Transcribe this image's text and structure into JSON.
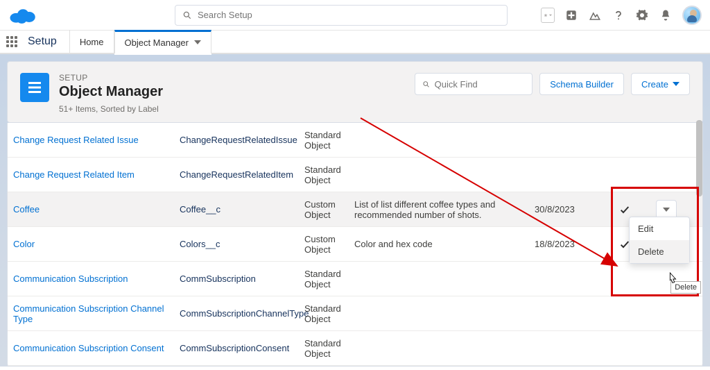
{
  "globalSearch": {
    "placeholder": "Search Setup"
  },
  "nav": {
    "appName": "Setup",
    "tabs": [
      {
        "label": "Home"
      },
      {
        "label": "Object Manager"
      }
    ]
  },
  "pageHeader": {
    "eyebrow": "SETUP",
    "title": "Object Manager",
    "meta": "51+ Items, Sorted by Label",
    "quickFindPlaceholder": "Quick Find",
    "schemaBtn": "Schema Builder",
    "createBtn": "Create"
  },
  "rows": [
    {
      "label": "Change Request Related Issue",
      "api": "ChangeRequestRelatedIssue",
      "type": "Standard Object",
      "desc": "",
      "date": "",
      "deployed": false,
      "hi": false
    },
    {
      "label": "Change Request Related Item",
      "api": "ChangeRequestRelatedItem",
      "type": "Standard Object",
      "desc": "",
      "date": "",
      "deployed": false,
      "hi": false
    },
    {
      "label": "Coffee",
      "api": "Coffee__c",
      "type": "Custom Object",
      "desc": "List of list different coffee types and recommended number of shots.",
      "date": "30/8/2023",
      "deployed": true,
      "hi": true
    },
    {
      "label": "Color",
      "api": "Colors__c",
      "type": "Custom Object",
      "desc": "Color and hex code",
      "date": "18/8/2023",
      "deployed": true,
      "hi": false
    },
    {
      "label": "Communication Subscription",
      "api": "CommSubscription",
      "type": "Standard Object",
      "desc": "",
      "date": "",
      "deployed": false,
      "hi": false
    },
    {
      "label": "Communication Subscription Channel Type",
      "api": "CommSubscriptionChannelType",
      "type": "Standard Object",
      "desc": "",
      "date": "",
      "deployed": false,
      "hi": false
    },
    {
      "label": "Communication Subscription Consent",
      "api": "CommSubscriptionConsent",
      "type": "Standard Object",
      "desc": "",
      "date": "",
      "deployed": false,
      "hi": false
    }
  ],
  "menu": {
    "edit": "Edit",
    "delete": "Delete"
  },
  "tooltip": "Delete"
}
